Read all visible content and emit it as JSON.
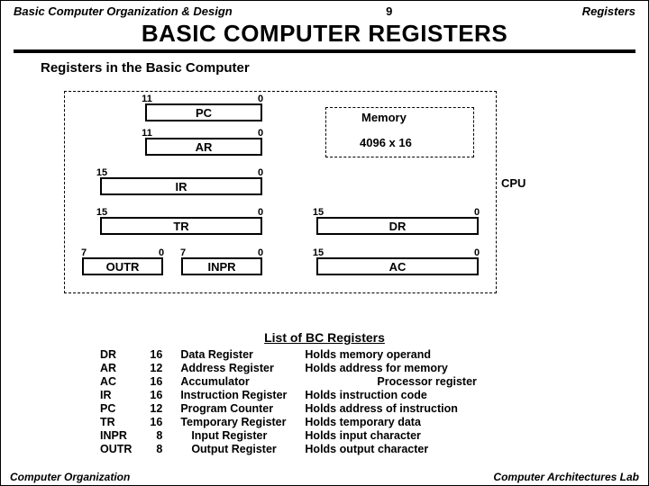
{
  "header": {
    "left": "Basic Computer Organization & Design",
    "page": "9",
    "right": "Registers"
  },
  "title": "BASIC COMPUTER  REGISTERS",
  "subhead": "Registers in the Basic Computer",
  "diagram": {
    "memory_label": "Memory",
    "memory_size": "4096 x 16",
    "cpu_label": "CPU",
    "regs": {
      "pc": {
        "name": "PC",
        "msb": "11",
        "lsb": "0"
      },
      "ar": {
        "name": "AR",
        "msb": "11",
        "lsb": "0"
      },
      "ir": {
        "name": "IR",
        "msb": "15",
        "lsb": "0"
      },
      "tr": {
        "name": "TR",
        "msb": "15",
        "lsb": "0"
      },
      "dr": {
        "name": "DR",
        "msb": "15",
        "lsb": "0"
      },
      "outr": {
        "name": "OUTR",
        "msb": "7",
        "lsb": "0"
      },
      "inpr": {
        "name": "INPR",
        "msb": "7",
        "lsb": "0"
      },
      "ac": {
        "name": "AC",
        "msb": "15",
        "lsb": "0"
      }
    }
  },
  "list_title": "List of BC Registers",
  "list": [
    {
      "sym": "DR",
      "bits": "16",
      "name": "Data Register",
      "desc": "Holds memory operand"
    },
    {
      "sym": "AR",
      "bits": "12",
      "name": "Address Register",
      "desc": "Holds address for memory"
    },
    {
      "sym": "AC",
      "bits": "16",
      "name": "Accumulator",
      "desc": "Processor register"
    },
    {
      "sym": "IR",
      "bits": "16",
      "name": "Instruction Register",
      "desc": "Holds instruction code"
    },
    {
      "sym": "PC",
      "bits": "12",
      "name": "Program Counter",
      "desc": "Holds address of instruction"
    },
    {
      "sym": "TR",
      "bits": "16",
      "name": "Temporary Register",
      "desc": "Holds temporary data"
    },
    {
      "sym": "INPR",
      "bits": "8",
      "name": "Input Register",
      "desc": "Holds input character"
    },
    {
      "sym": "OUTR",
      "bits": "8",
      "name": "Output Register",
      "desc": "Holds output character"
    }
  ],
  "footer": {
    "left": "Computer Organization",
    "right": "Computer Architectures Lab"
  }
}
